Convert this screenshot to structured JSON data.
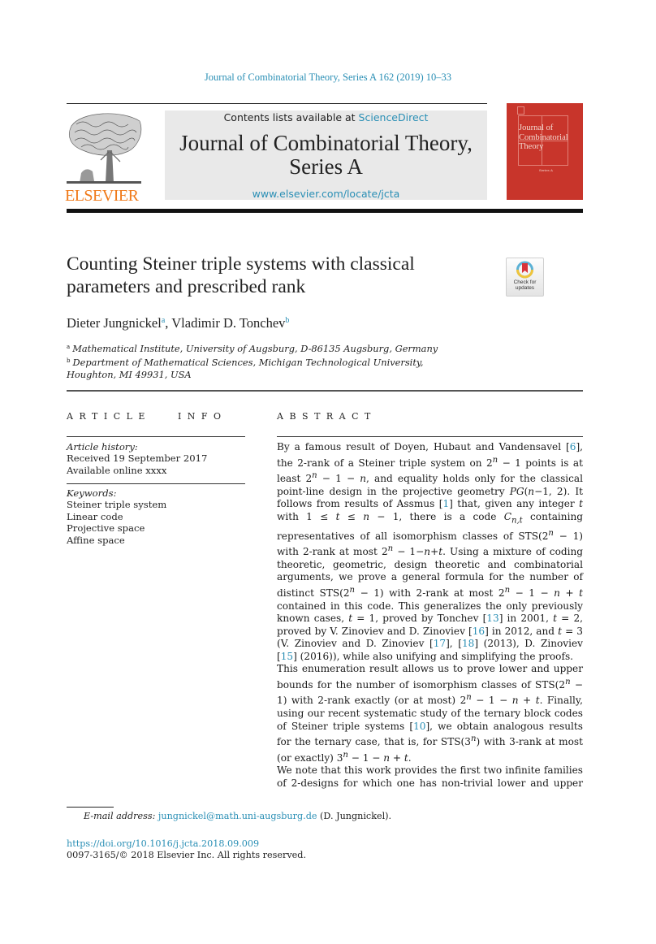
{
  "running_head": "Journal of Combinatorial Theory, Series A 162 (2019) 10–33",
  "masthead": {
    "publisher_logo_text": "ELSEVIER",
    "contents_prefix": "Contents lists available at ",
    "contents_link": "ScienceDirect",
    "journal_title_line1": "Journal of Combinatorial Theory,",
    "journal_title_line2": "Series A",
    "journal_url": "www.elsevier.com/locate/jcta",
    "cover_title_lines": [
      "Journal of",
      "Combinatorial",
      "Theory"
    ],
    "cover_series": "Series A",
    "brand_orange": "#f07a1a",
    "link_color": "#2a8fb5",
    "cover_color": "#c8352b"
  },
  "article": {
    "title_line1": "Counting Steiner triple systems with classical",
    "title_line2": "parameters and prescribed rank",
    "crossmark_label_line1": "Check for",
    "crossmark_label_line2": "updates",
    "authors": [
      {
        "name": "Dieter Jungnickel",
        "aff": "a",
        "sep": ", "
      },
      {
        "name": "Vladimir D. Tonchev",
        "aff": "b",
        "sep": ""
      }
    ],
    "affiliations": [
      {
        "mark": "a",
        "text": "Mathematical Institute, University of Augsburg, D-86135 Augsburg, Germany"
      },
      {
        "mark": "b",
        "text": "Department of Mathematical Sciences, Michigan Technological University,",
        "text2": "Houghton, MI 49931, USA"
      }
    ]
  },
  "article_info": {
    "heading": "ARTICLE   INFO",
    "history_label": "Article history:",
    "received": "Received 19 September 2017",
    "available": "Available online xxxx",
    "keywords_label": "Keywords:",
    "keywords": [
      "Steiner triple system",
      "Linear code",
      "Projective space",
      "Affine space"
    ]
  },
  "abstract": {
    "heading": "ABSTRACT",
    "refs": {
      "r6": "6",
      "r1": "1",
      "r13": "13",
      "r16": "16",
      "r17": "17",
      "r18": "18",
      "r15": "15",
      "r10": "10"
    },
    "t": {
      "p1a": "By a famous result of Doyen, Hubaut and Vandensavel [",
      "p1b": "], the 2-rank of a Steiner triple system on 2",
      "p1c": " − 1 points is at least 2",
      "p1d": " − 1 − ",
      "p1e": ", and equality holds only for the classical point-line design in the projective geometry ",
      "p1f": "(",
      "p1g": "−1, 2). It follows from results of Assmus [",
      "p1h": "] that, given any integer ",
      "p1i": " with 1 ≤ ",
      "p1j": " ≤ ",
      "p1k": " − 1, there is a code ",
      "p1l": " containing representatives of all isomorphism classes of STS(2",
      "p1m": " − 1) with 2-rank at most 2",
      "p1n": " − 1−",
      "p1o": "+",
      "p1p": ". Using a mixture of coding theoretic, geometric, design theoretic and combinatorial arguments, we prove a general formula for the number of distinct STS(2",
      "p1q": " − 1) with 2-rank at most 2",
      "p1r": " − 1 − ",
      "p1s": " + ",
      "p1t": " contained in this code. This generalizes the only previously known cases, ",
      "p1u": " = 1, proved by Tonchev [",
      "p1v": "] in 2001, ",
      "p1w": " = 2, proved by V. Zinoviev and D. Zinoviev [",
      "p1x": "] in 2012, and ",
      "p1y": " = 3 (V. Zinoviev and D. Zinoviev [",
      "p1z": "], [",
      "p1aa": "] (2013), D. Zinoviev [",
      "p1ab": "] (2016)), while also unifying and simplifying the proofs.",
      "p2a": "This enumeration result allows us to prove lower and upper bounds for the number of isomorphism classes of STS(2",
      "p2b": " − 1) with 2-rank exactly (or at most) 2",
      "p2c": " − 1 − ",
      "p2d": " + ",
      "p2e": ". Finally, using our recent systematic study of the ternary block codes of Steiner triple systems [",
      "p2f": "], we obtain analogous results for the ternary case, that is, for STS(3",
      "p2g": ") with 3-rank at most (or exactly) 3",
      "p2h": " − 1 − ",
      "p2i": " + ",
      "p2j": ".",
      "p3": "We note that this work provides the first two infinite families of 2-designs for which one has non-trivial lower and upper",
      "n": "n",
      "t": "t",
      "PG": "PG",
      "C": "C",
      "Csub": "n,t"
    }
  },
  "footer": {
    "email_label": "E-mail address:",
    "email": "jungnickel@math.uni-augsburg.de",
    "email_owner": " (D. Jungnickel).",
    "doi": "https://doi.org/10.1016/j.jcta.2018.09.009",
    "copyright": "0097-3165/© 2018 Elsevier Inc. All rights reserved."
  }
}
